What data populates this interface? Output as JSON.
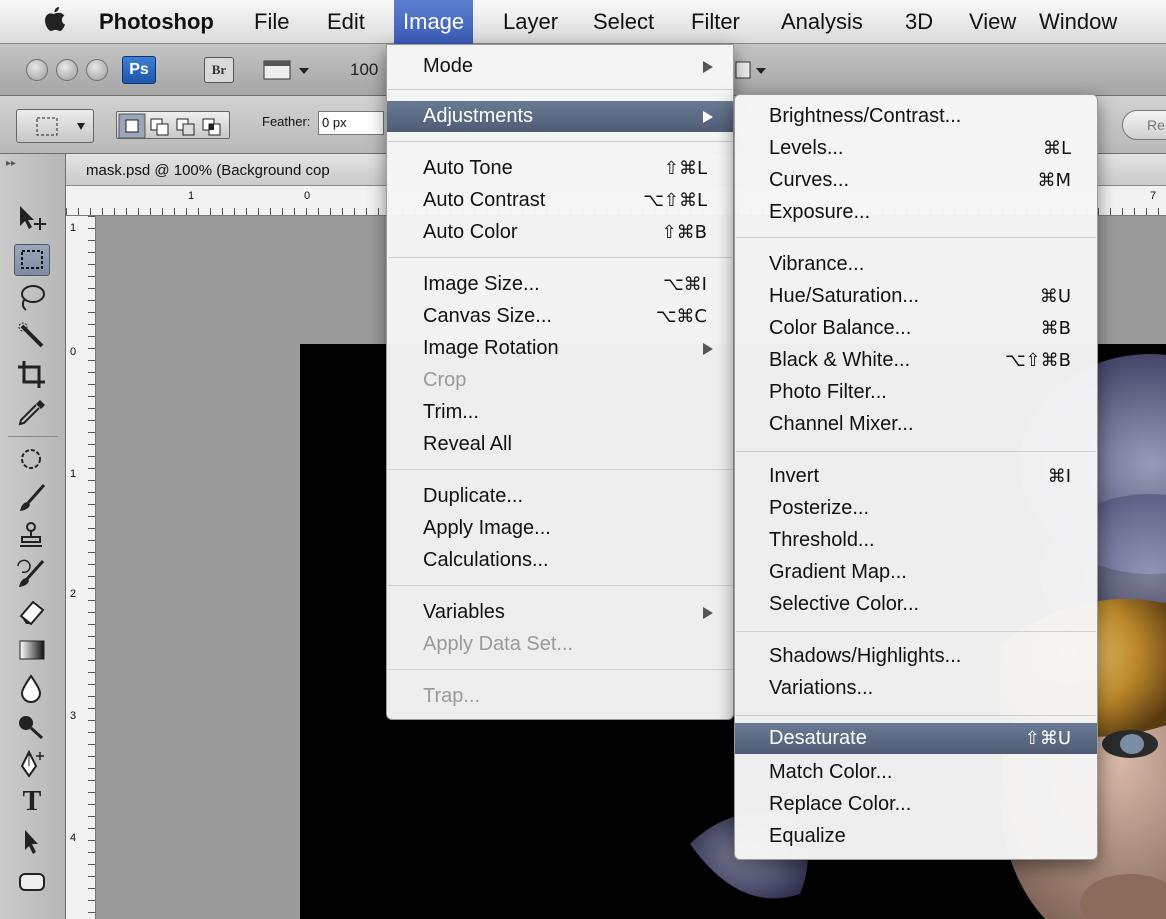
{
  "menubar": {
    "app_name": "Photoshop",
    "items": [
      "File",
      "Edit",
      "Image",
      "Layer",
      "Select",
      "Filter",
      "Analysis",
      "3D",
      "View",
      "Window"
    ]
  },
  "appbar": {
    "ps_label": "Ps",
    "br_label": "Br",
    "zoom": "100"
  },
  "options": {
    "feather_label": "Feather:",
    "feather_value": "0 px",
    "right_button": "Re"
  },
  "document": {
    "tab_title": "mask.psd @ 100% (Background cop",
    "ruler_h": [
      "1",
      "0",
      "7"
    ],
    "ruler_v": [
      "1",
      "0",
      "1",
      "2",
      "3",
      "4"
    ]
  },
  "image_menu": {
    "items": [
      {
        "label": "Mode",
        "submenu": true
      },
      {
        "label": "Adjustments",
        "submenu": true,
        "highlighted": true
      },
      {
        "label": "Auto Tone",
        "shortcut": "⇧⌘L"
      },
      {
        "label": "Auto Contrast",
        "shortcut": "⌥⇧⌘L"
      },
      {
        "label": "Auto Color",
        "shortcut": "⇧⌘B"
      },
      {
        "label": "Image Size...",
        "shortcut": "⌥⌘I"
      },
      {
        "label": "Canvas Size...",
        "shortcut": "⌥⌘C"
      },
      {
        "label": "Image Rotation",
        "submenu": true
      },
      {
        "label": "Crop",
        "disabled": true
      },
      {
        "label": "Trim..."
      },
      {
        "label": "Reveal All"
      },
      {
        "label": "Duplicate..."
      },
      {
        "label": "Apply Image..."
      },
      {
        "label": "Calculations..."
      },
      {
        "label": "Variables",
        "submenu": true
      },
      {
        "label": "Apply Data Set...",
        "disabled": true
      },
      {
        "label": "Trap...",
        "disabled": true
      }
    ]
  },
  "adjustments_menu": {
    "items": [
      {
        "label": "Brightness/Contrast..."
      },
      {
        "label": "Levels...",
        "shortcut": "⌘L"
      },
      {
        "label": "Curves...",
        "shortcut": "⌘M"
      },
      {
        "label": "Exposure..."
      },
      {
        "label": "Vibrance..."
      },
      {
        "label": "Hue/Saturation...",
        "shortcut": "⌘U"
      },
      {
        "label": "Color Balance...",
        "shortcut": "⌘B"
      },
      {
        "label": "Black & White...",
        "shortcut": "⌥⇧⌘B"
      },
      {
        "label": "Photo Filter..."
      },
      {
        "label": "Channel Mixer..."
      },
      {
        "label": "Invert",
        "shortcut": "⌘I"
      },
      {
        "label": "Posterize..."
      },
      {
        "label": "Threshold..."
      },
      {
        "label": "Gradient Map..."
      },
      {
        "label": "Selective Color..."
      },
      {
        "label": "Shadows/Highlights..."
      },
      {
        "label": "Variations..."
      },
      {
        "label": "Desaturate",
        "shortcut": "⇧⌘U",
        "highlighted": true
      },
      {
        "label": "Match Color..."
      },
      {
        "label": "Replace Color..."
      },
      {
        "label": "Equalize"
      }
    ]
  },
  "tools": [
    "move-tool",
    "marquee-tool",
    "lasso-tool",
    "quick-selection-tool",
    "crop-tool",
    "eyedropper-tool",
    "spot-healing-tool",
    "brush-tool",
    "clone-stamp-tool",
    "history-brush-tool",
    "eraser-tool",
    "gradient-tool",
    "blur-tool",
    "dodge-tool",
    "pen-tool",
    "type-tool",
    "path-selection-tool",
    "shape-tool"
  ],
  "colors": {
    "menu_highlight": "#5a6982",
    "menubar_active": "#3a5bb8",
    "canvas": "#000000"
  }
}
